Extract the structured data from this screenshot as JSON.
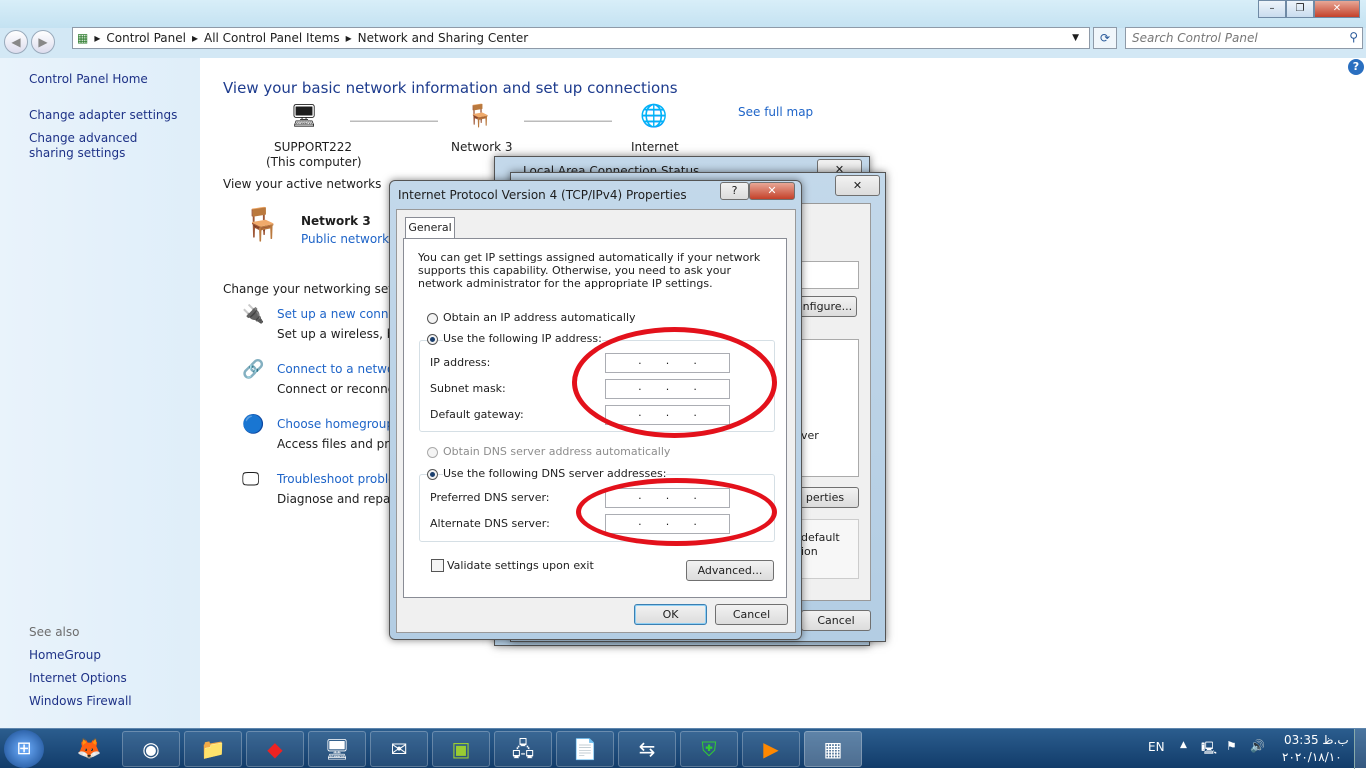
{
  "window": {
    "minimize": "–",
    "maximize": "❐",
    "close": "✕"
  },
  "nav": {
    "back": "◀",
    "forward": "▶",
    "breadcrumb": [
      "Control Panel",
      "All Control Panel Items",
      "Network and Sharing Center"
    ],
    "refresh": "⟳",
    "search_placeholder": "Search Control Panel"
  },
  "sidebar": {
    "home": "Control Panel Home",
    "items": [
      "Change adapter settings",
      "Change advanced sharing settings"
    ],
    "see_also": "See also",
    "see_also_items": [
      "HomeGroup",
      "Internet Options",
      "Windows Firewall"
    ]
  },
  "main": {
    "title": "View your basic network information and set up connections",
    "see_full_map": "See full map",
    "map": {
      "computer": "SUPPORT222",
      "computer_sub": "(This computer)",
      "network": "Network 3",
      "internet": "Internet"
    },
    "active_label": "View your active networks",
    "active_network": {
      "name": "Network 3",
      "type": "Public network"
    },
    "change_label": "Change your networking setting",
    "tasks": [
      {
        "link": "Set up a new connect",
        "desc": "Set up a wireless, broa"
      },
      {
        "link": "Connect to a network",
        "desc": "Connect or reconnect"
      },
      {
        "link": "Choose homegroup a",
        "desc": "Access files and print"
      },
      {
        "link": "Troubleshoot probler",
        "desc": "Diagnose and repair n"
      }
    ]
  },
  "bg_dialogs": {
    "status_title": "Local Area Connection Status",
    "configure": "onfigure...",
    "properties": "perties",
    "ver": "ver",
    "default1": "default",
    "default2": "ion",
    "cancel": "Cancel"
  },
  "dialog": {
    "title": "Internet Protocol Version 4 (TCP/IPv4) Properties",
    "help": "?",
    "close": "✕",
    "tab": "General",
    "intro": "You can get IP settings assigned automatically if your network supports this capability. Otherwise, you need to ask your network administrator for the appropriate IP settings.",
    "obtain_ip": "Obtain an IP address automatically",
    "use_ip": "Use the following IP address:",
    "ip_mode": "manual",
    "ip_fields": [
      {
        "label": "IP address:",
        "value": ""
      },
      {
        "label": "Subnet mask:",
        "value": ""
      },
      {
        "label": "Default gateway:",
        "value": ""
      }
    ],
    "obtain_dns": "Obtain DNS server address automatically",
    "use_dns": "Use the following DNS server addresses:",
    "dns_mode": "manual",
    "dns_fields": [
      {
        "label": "Preferred DNS server:",
        "value": ""
      },
      {
        "label": "Alternate DNS server:",
        "value": ""
      }
    ],
    "validate": "Validate settings upon exit",
    "validate_checked": false,
    "advanced": "Advanced...",
    "ok": "OK",
    "cancel": "Cancel",
    "dot": "."
  },
  "annotation_color": "#e3111b",
  "taskbar": {
    "lang": "EN",
    "time": "03:35 ب.ظ",
    "date": "۲۰۲۰/۱۸/۱۰",
    "apps": [
      "firefox",
      "chrome",
      "file-explorer",
      "anydesk",
      "remote-desktop",
      "outlook",
      "vmware",
      "network",
      "notepad",
      "teamviewer",
      "kaspersky",
      "media-player",
      "control-panel"
    ]
  }
}
